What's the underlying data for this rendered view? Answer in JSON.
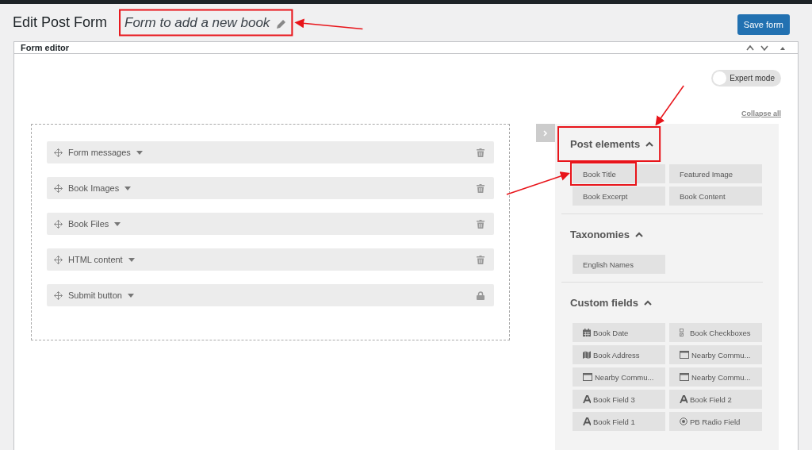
{
  "page_title": "Edit Post Form",
  "form_name": "Form to add a new book",
  "save_button": "Save form",
  "panel_title": "Form editor",
  "expert_mode": {
    "label": "Expert mode",
    "on": false
  },
  "collapse_all": "Collapse all",
  "form_rows": [
    {
      "label": "Form messages",
      "locked": false
    },
    {
      "label": "Book Images",
      "locked": false
    },
    {
      "label": "Book Files",
      "locked": false
    },
    {
      "label": "HTML content",
      "locked": false
    },
    {
      "label": "Submit button",
      "locked": true
    }
  ],
  "sections": [
    {
      "title": "Post elements",
      "expanded": true,
      "items": [
        {
          "label": "Book Title",
          "kind": "plain"
        },
        {
          "label": "Featured Image",
          "kind": "plain"
        },
        {
          "label": "Book Excerpt",
          "kind": "plain"
        },
        {
          "label": "Book Content",
          "kind": "plain"
        }
      ]
    },
    {
      "title": "Taxonomies",
      "expanded": true,
      "items": [
        {
          "label": "English Names",
          "kind": "plain"
        }
      ]
    },
    {
      "title": "Custom fields",
      "expanded": true,
      "items": [
        {
          "label": "Book Date",
          "kind": "date"
        },
        {
          "label": "Book Checkboxes",
          "kind": "checkbox"
        },
        {
          "label": "Book Address",
          "kind": "map"
        },
        {
          "label": "Nearby Commu...",
          "kind": "window"
        },
        {
          "label": "Nearby Commu...",
          "kind": "window"
        },
        {
          "label": "Nearby Commu...",
          "kind": "window"
        },
        {
          "label": "Book Field 3",
          "kind": "text"
        },
        {
          "label": "Book Field 2",
          "kind": "text"
        },
        {
          "label": "Book Field 1",
          "kind": "text"
        },
        {
          "label": "PB Radio Field",
          "kind": "radio"
        }
      ]
    }
  ]
}
